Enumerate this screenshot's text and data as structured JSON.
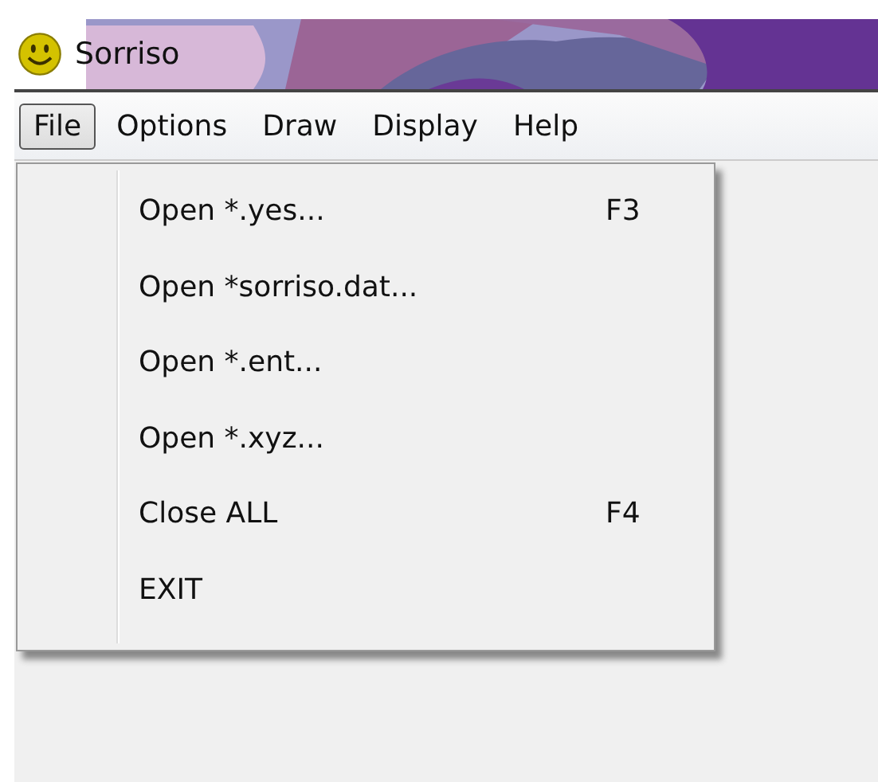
{
  "window": {
    "title": "Sorriso"
  },
  "menu_bar": [
    {
      "label": "File",
      "selected": true
    },
    {
      "label": "Options",
      "selected": false
    },
    {
      "label": "Draw",
      "selected": false
    },
    {
      "label": "Display",
      "selected": false
    },
    {
      "label": "Help",
      "selected": false
    }
  ],
  "file_menu": [
    {
      "label": "Open *.yes...",
      "shortcut": "F3"
    },
    {
      "label": "Open *sorriso.dat..."
    },
    {
      "label": "Open *.ent..."
    },
    {
      "label": "Open *.xyz..."
    },
    {
      "label": "Close ALL",
      "shortcut": "F4"
    },
    {
      "label": "EXIT"
    }
  ]
}
